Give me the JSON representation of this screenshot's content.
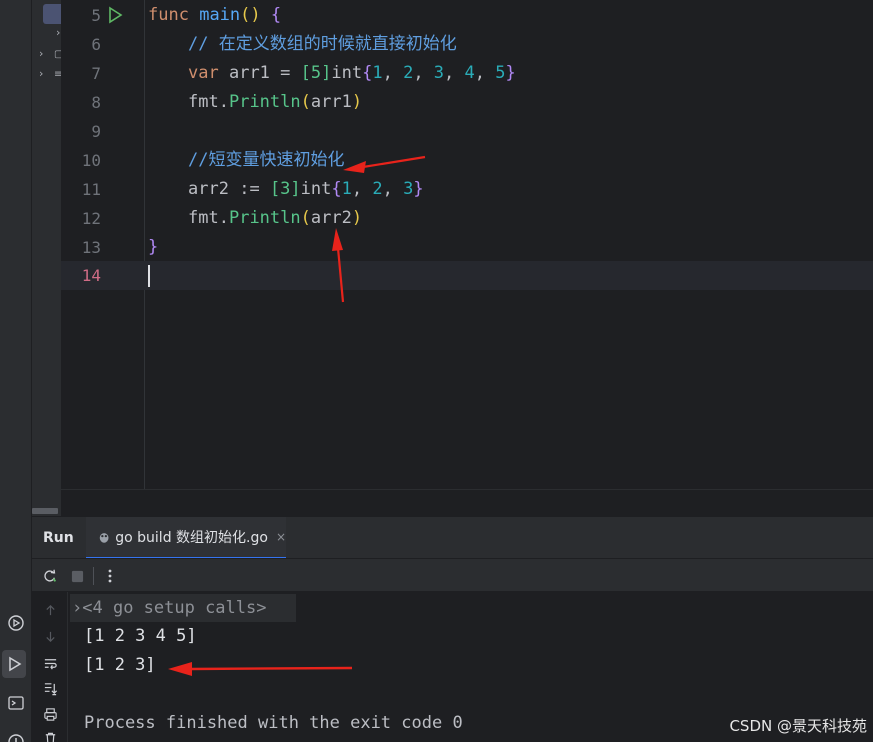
{
  "editor": {
    "lines": [
      {
        "num": "5"
      },
      {
        "num": "6",
        "text": "// 在定义数组的时候就直接初始化"
      },
      {
        "num": "7"
      },
      {
        "num": "8"
      },
      {
        "num": "9"
      },
      {
        "num": "10",
        "text": "//短变量快速初始化"
      },
      {
        "num": "11"
      },
      {
        "num": "12"
      },
      {
        "num": "13"
      },
      {
        "num": "14"
      }
    ],
    "tokens": {
      "func": "func",
      "main": "main",
      "parens": "()",
      "open_brace": "{",
      "close_brace": "}",
      "var": "var",
      "arr1": "arr1",
      "eq": " = ",
      "decl": ":=",
      "arr2": "arr2",
      "size5": "[5]",
      "size3": "[3]",
      "int": "int",
      "fmt": "fmt",
      "dot": ".",
      "println": "Println",
      "n1": "1",
      "n2": "2",
      "n3": "3",
      "n4": "4",
      "n5": "5",
      "comma": ", ",
      "lparen": "(",
      "rparen": ")",
      "lbrace": "{",
      "rbrace": "}"
    }
  },
  "run": {
    "title": "Run",
    "tab_label": "go build 数组初始化.go",
    "tab_close": "×",
    "setup_calls": "<4 go setup calls>",
    "output": [
      "[1 2 3 4 5]",
      "[1 2 3]"
    ],
    "exit_message": "Process finished with the exit code 0"
  },
  "watermark": "CSDN @景天科技苑",
  "colors": {
    "annotation_arrow": "#e8231b",
    "accent": "#3574f0"
  }
}
